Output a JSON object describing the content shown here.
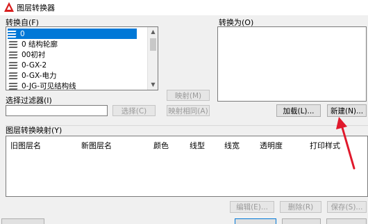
{
  "window": {
    "title": "图层转换器"
  },
  "convert_from": {
    "label": "转换自(F)",
    "items": [
      "0",
      "0 结构轮廓",
      "00初衬",
      "0-GX-2",
      "0-GX-电力",
      "0-JG-可见结构线"
    ],
    "selected_index": 0
  },
  "convert_to": {
    "label": "转换为(O)"
  },
  "filter": {
    "label": "选择过滤器(I)",
    "value": ""
  },
  "buttons": {
    "select": "选择(C)",
    "map": "映射(M)",
    "map_same": "映射相同(A)",
    "load": "加载(L)...",
    "new": "新建(N)...",
    "edit": "编辑(E)...",
    "delete": "删除(R)",
    "save": "保存(S)..."
  },
  "mapping": {
    "label": "图层转换映射(Y)",
    "columns": [
      "旧图层名",
      "新图层名",
      "颜色",
      "线型",
      "线宽",
      "透明度",
      "打印样式"
    ]
  },
  "colors": {
    "accent": "#0078d7",
    "annotation_arrow": "#e0192c"
  }
}
